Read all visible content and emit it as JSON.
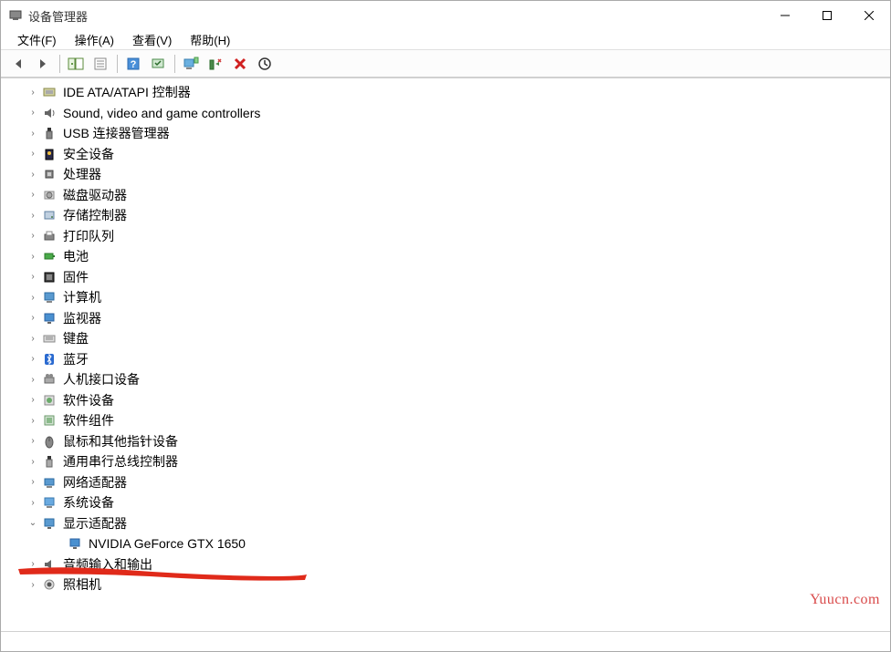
{
  "window": {
    "title": "设备管理器"
  },
  "menubar": {
    "items": [
      {
        "label": "文件(F)"
      },
      {
        "label": "操作(A)"
      },
      {
        "label": "查看(V)"
      },
      {
        "label": "帮助(H)"
      }
    ]
  },
  "toolbar": {
    "back": "back-icon",
    "forward": "forward-icon",
    "show_hide": "show-hide-icon",
    "properties": "properties-icon",
    "help": "help-icon",
    "scan": "scan-icon",
    "monitor": "monitor-icon",
    "add": "add-device-icon",
    "remove": "remove-icon",
    "update": "update-icon"
  },
  "tree": {
    "nodes": [
      {
        "label": "IDE ATA/ATAPI 控制器",
        "icon": "ide-icon",
        "expanded": false
      },
      {
        "label": "Sound, video and game controllers",
        "icon": "sound-icon",
        "expanded": false
      },
      {
        "label": "USB 连接器管理器",
        "icon": "usb-icon",
        "expanded": false
      },
      {
        "label": "安全设备",
        "icon": "security-icon",
        "expanded": false
      },
      {
        "label": "处理器",
        "icon": "cpu-icon",
        "expanded": false
      },
      {
        "label": "磁盘驱动器",
        "icon": "disk-icon",
        "expanded": false
      },
      {
        "label": "存储控制器",
        "icon": "storage-icon",
        "expanded": false
      },
      {
        "label": "打印队列",
        "icon": "printer-icon",
        "expanded": false
      },
      {
        "label": "电池",
        "icon": "battery-icon",
        "expanded": false
      },
      {
        "label": "固件",
        "icon": "firmware-icon",
        "expanded": false
      },
      {
        "label": "计算机",
        "icon": "computer-icon",
        "expanded": false
      },
      {
        "label": "监视器",
        "icon": "monitor-icon",
        "expanded": false
      },
      {
        "label": "键盘",
        "icon": "keyboard-icon",
        "expanded": false
      },
      {
        "label": "蓝牙",
        "icon": "bluetooth-icon",
        "expanded": false
      },
      {
        "label": "人机接口设备",
        "icon": "hid-icon",
        "expanded": false
      },
      {
        "label": "软件设备",
        "icon": "software-icon",
        "expanded": false
      },
      {
        "label": "软件组件",
        "icon": "component-icon",
        "expanded": false
      },
      {
        "label": "鼠标和其他指针设备",
        "icon": "mouse-icon",
        "expanded": false
      },
      {
        "label": "通用串行总线控制器",
        "icon": "usb-ctrl-icon",
        "expanded": false
      },
      {
        "label": "网络适配器",
        "icon": "network-icon",
        "expanded": false
      },
      {
        "label": "系统设备",
        "icon": "system-icon",
        "expanded": false
      },
      {
        "label": "显示适配器",
        "icon": "display-icon",
        "expanded": true,
        "children": [
          {
            "label": "NVIDIA GeForce GTX 1650",
            "icon": "gpu-icon"
          }
        ]
      },
      {
        "label": "音频输入和输出",
        "icon": "audio-icon",
        "expanded": false
      },
      {
        "label": "照相机",
        "icon": "camera-icon",
        "expanded": false
      }
    ]
  },
  "watermark": "Yuucn.com"
}
